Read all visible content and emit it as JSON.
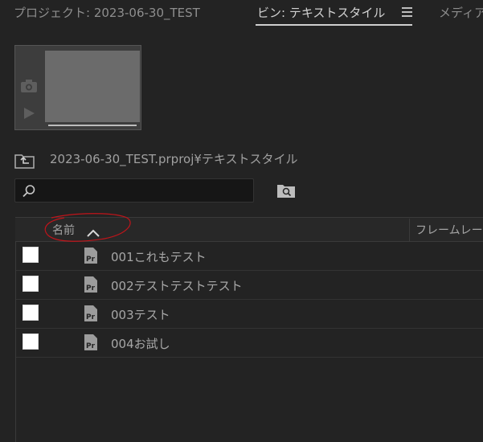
{
  "tabs": {
    "project": "プロジェクト: 2023-06-30_TEST",
    "bin": "ビン: テキストスタイル",
    "media": "メディア"
  },
  "path": "2023-06-30_TEST.prproj¥テキストスタイル",
  "search": {
    "value": "",
    "placeholder": ""
  },
  "columns": {
    "name": "名前",
    "frame_rate": "フレームレー"
  },
  "items": [
    {
      "label": "001これもテスト",
      "checked": false
    },
    {
      "label": "002テストテストテスト",
      "checked": false
    },
    {
      "label": "003テスト",
      "checked": false
    },
    {
      "label": "004お試し",
      "checked": false
    }
  ],
  "colors": {
    "annotation": "#c0141a",
    "background": "#232323",
    "underline": "#cfcfcf"
  },
  "icons": [
    "menu-icon",
    "camera-icon",
    "play-icon",
    "up-folder-icon",
    "search-icon",
    "find-icon",
    "sort-ascending-icon",
    "premiere-file-icon"
  ]
}
